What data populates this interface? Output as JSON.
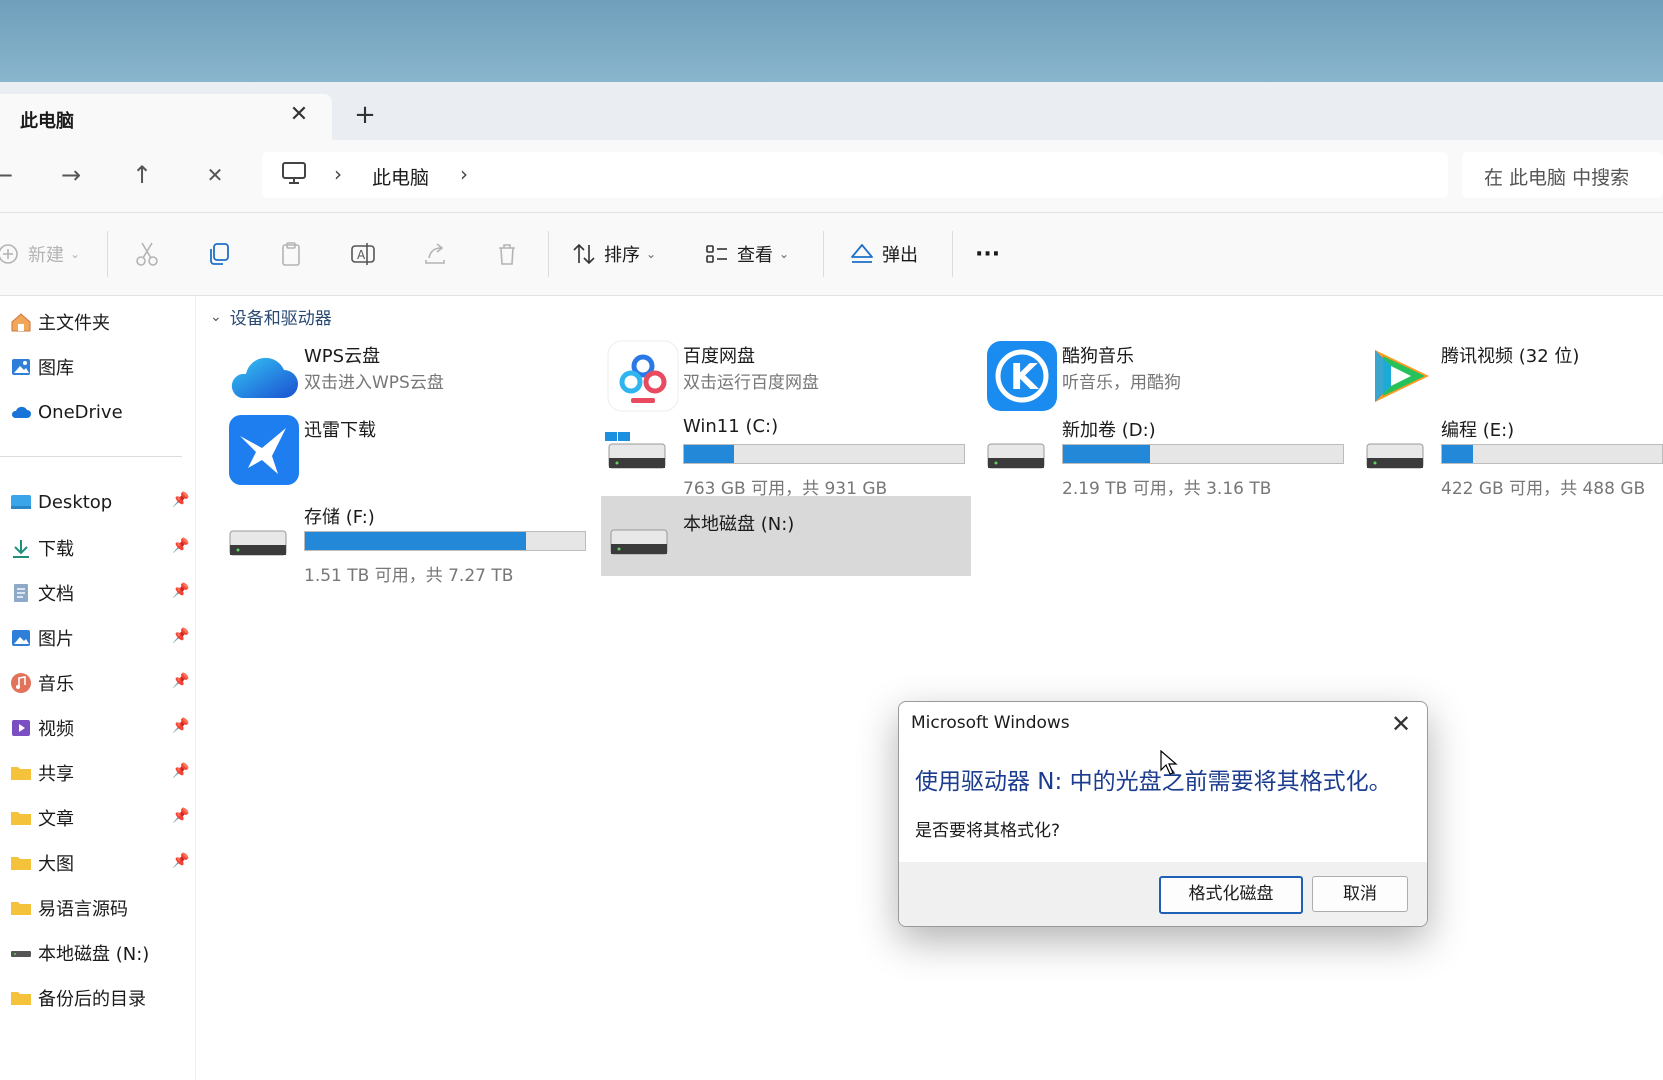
{
  "tab": {
    "title": "此电脑",
    "close": "✕",
    "add": "+"
  },
  "nav": {
    "back": "←",
    "forward": "→",
    "up": "↑",
    "stop": "✕",
    "breadcrumb": [
      "此电脑"
    ],
    "chevron": "›",
    "search_placeholder": "在 此电脑 中搜索"
  },
  "toolbar": {
    "new_label": "新建",
    "sort_label": "排序",
    "view_label": "查看",
    "eject_label": "弹出",
    "more_label": "···"
  },
  "sidebar": {
    "quick": [
      {
        "label": "主文件夹",
        "icon": "home-icon"
      },
      {
        "label": "图库",
        "icon": "gallery-icon"
      },
      {
        "label": "OneDrive",
        "icon": "cloud-icon"
      }
    ],
    "pinned": [
      {
        "label": "Desktop",
        "icon": "desktop-folder-icon",
        "pinned": true
      },
      {
        "label": "下载",
        "icon": "download-icon",
        "pinned": true
      },
      {
        "label": "文档",
        "icon": "documents-icon",
        "pinned": true
      },
      {
        "label": "图片",
        "icon": "pictures-icon",
        "pinned": true
      },
      {
        "label": "音乐",
        "icon": "music-icon",
        "pinned": true
      },
      {
        "label": "视频",
        "icon": "video-icon",
        "pinned": true
      },
      {
        "label": "共享",
        "icon": "folder-icon",
        "pinned": true
      },
      {
        "label": "文章",
        "icon": "folder-icon",
        "pinned": true
      },
      {
        "label": "大图",
        "icon": "folder-icon",
        "pinned": true
      },
      {
        "label": "易语言源码",
        "icon": "folder-icon",
        "pinned": false
      },
      {
        "label": "本地磁盘 (N:)",
        "icon": "drive-icon",
        "pinned": false
      },
      {
        "label": "备份后的目录",
        "icon": "folder-icon",
        "pinned": false
      }
    ],
    "pin_glyph": "📌"
  },
  "content": {
    "group_title": "设备和驱动器",
    "apps": [
      {
        "name": "WPS云盘",
        "sub": "双击进入WPS云盘",
        "icon": "wps-cloud-icon"
      },
      {
        "name": "百度网盘",
        "sub": "双击运行百度网盘",
        "icon": "baidu-netdisk-icon"
      },
      {
        "name": "酷狗音乐",
        "sub": "听音乐，用酷狗",
        "icon": "kugou-icon"
      },
      {
        "name": "腾讯视频 (32 位)",
        "sub": "",
        "icon": "tencent-video-icon"
      },
      {
        "name": "迅雷下载",
        "sub": "",
        "icon": "xunlei-icon"
      }
    ],
    "drives": [
      {
        "name": "Win11 (C:)",
        "capacity": "763 GB 可用，共 931 GB",
        "used_fraction": 0.18
      },
      {
        "name": "新加卷 (D:)",
        "capacity": "2.19 TB 可用，共 3.16 TB",
        "used_fraction": 0.31
      },
      {
        "name": "编程 (E:)",
        "capacity": "422 GB 可用，共 488 GB",
        "used_fraction": 0.14
      },
      {
        "name": "存储 (F:)",
        "capacity": "1.51 TB 可用，共 7.27 TB",
        "used_fraction": 0.79
      },
      {
        "name": "本地磁盘 (N:)",
        "capacity": "",
        "used_fraction": null
      }
    ]
  },
  "dialog": {
    "title": "Microsoft Windows",
    "close": "✕",
    "message": "使用驱动器 N: 中的光盘之前需要将其格式化。",
    "question": "是否要将其格式化?",
    "primary_button": "格式化磁盘",
    "cancel_button": "取消"
  },
  "colors": {
    "accent": "#2388d8",
    "dialog_text": "#1c3d8f"
  }
}
